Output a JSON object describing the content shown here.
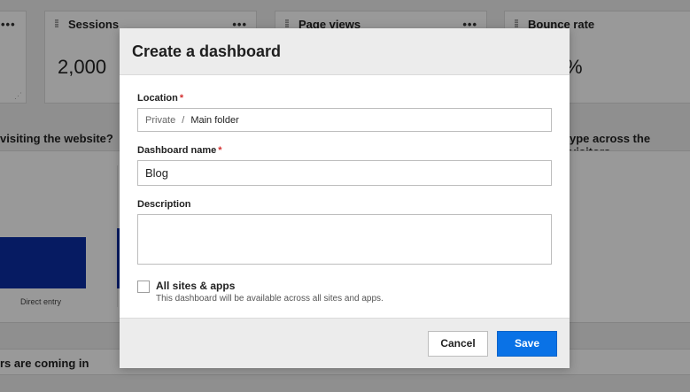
{
  "background": {
    "cards": [
      {
        "title": "",
        "more": "•••"
      },
      {
        "title": "Sessions",
        "more": "•••",
        "value": "2,000"
      },
      {
        "title": "Page views",
        "more": "•••"
      },
      {
        "title": "Bounce rate",
        "more": "•••",
        "value": "%"
      }
    ],
    "sections": {
      "left_question": "visiting the website?",
      "right_question": "ype across the visitors",
      "bottom_question": "rs are coming in"
    },
    "chart": {
      "category_label": "Direct entry",
      "bar_color": "#0b2ea3"
    }
  },
  "modal": {
    "title": "Create a dashboard",
    "location": {
      "label": "Location",
      "required_mark": "*",
      "private": "Private",
      "separator": "/",
      "folder": "Main folder"
    },
    "name": {
      "label": "Dashboard name",
      "required_mark": "*",
      "value": "Blog"
    },
    "description": {
      "label": "Description",
      "value": ""
    },
    "all_sites": {
      "label": "All sites & apps",
      "hint": "This dashboard will be available across all sites and apps.",
      "checked": false
    },
    "buttons": {
      "cancel": "Cancel",
      "save": "Save"
    },
    "colors": {
      "primary": "#0a72e6",
      "required": "#d32f2f"
    }
  }
}
